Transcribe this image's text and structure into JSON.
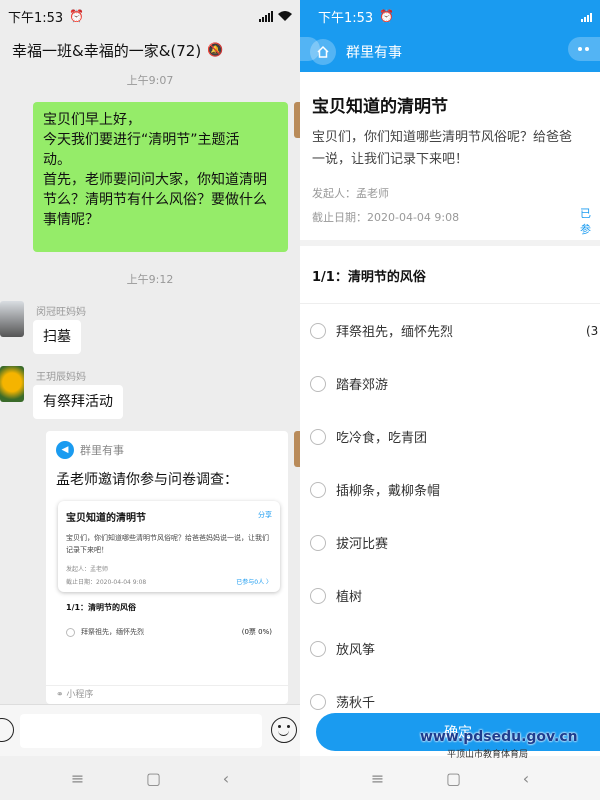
{
  "left": {
    "status": {
      "time": "下午1:53",
      "signal": "4G"
    },
    "chat_title": "幸福一班&幸福的一家&(72)",
    "time1": "上午9:07",
    "teacher_message": [
      "宝贝们早上好，",
      "今天我们要进行“清明节”主题活",
      "动。",
      "首先，老师要问问大家，你知道清明",
      "节么？清明节有什么风俗？要做什么",
      "事情呢？"
    ],
    "time2": "上午9:12",
    "messages": [
      {
        "sender": "闵冠旺妈妈",
        "text": "扫墓"
      },
      {
        "sender": "王玥辰妈妈",
        "text": "有祭拜活动"
      }
    ],
    "card": {
      "app_name": "群里有事",
      "invite": "孟老师邀请你参与问卷调查：",
      "inner_title": "宝贝知道的清明节",
      "inner_share": "分享",
      "inner_desc": "宝贝们，你们知道哪些清明节风俗呢？给爸爸妈妈说一说，让我们记录下来吧！",
      "inner_initiator": "发起人：孟老师",
      "inner_deadline": "截止日期：2020-04-04 9:08",
      "inner_joined": "已参与0人 〉",
      "question": "1/1：清明节的风俗",
      "first_option": "拜祭祖先，缅怀先烈",
      "first_pct": "(0票 0%)",
      "mini_program": "小程序"
    }
  },
  "right": {
    "status": {
      "time": "下午1:53"
    },
    "app_title": "群里有事",
    "survey_title": "宝贝知道的清明节",
    "survey_desc": [
      "宝贝们，你们知道哪些清明节风俗呢？给爸爸",
      "一说，让我们记录下来吧！"
    ],
    "initiator": "发起人：孟老师",
    "deadline": "截止日期：2020-04-04 9:08",
    "joined": "已参",
    "question_header": "1/1：清明节的风俗",
    "options": [
      "拜祭祖先，缅怀先烈",
      "踏春郊游",
      "吃冷食，吃青团",
      "插柳条，戴柳条帽",
      "拔河比赛",
      "植树",
      "放风筝",
      "荡秋千"
    ],
    "first_count": "(3",
    "confirm_label": "确定"
  },
  "watermark": {
    "url": "www.pdsedu.gov.cn",
    "org": "平顶山市教育体育局"
  },
  "colors": {
    "accent_blue": "#1a9bf0",
    "bubble_green": "#95ec69"
  }
}
